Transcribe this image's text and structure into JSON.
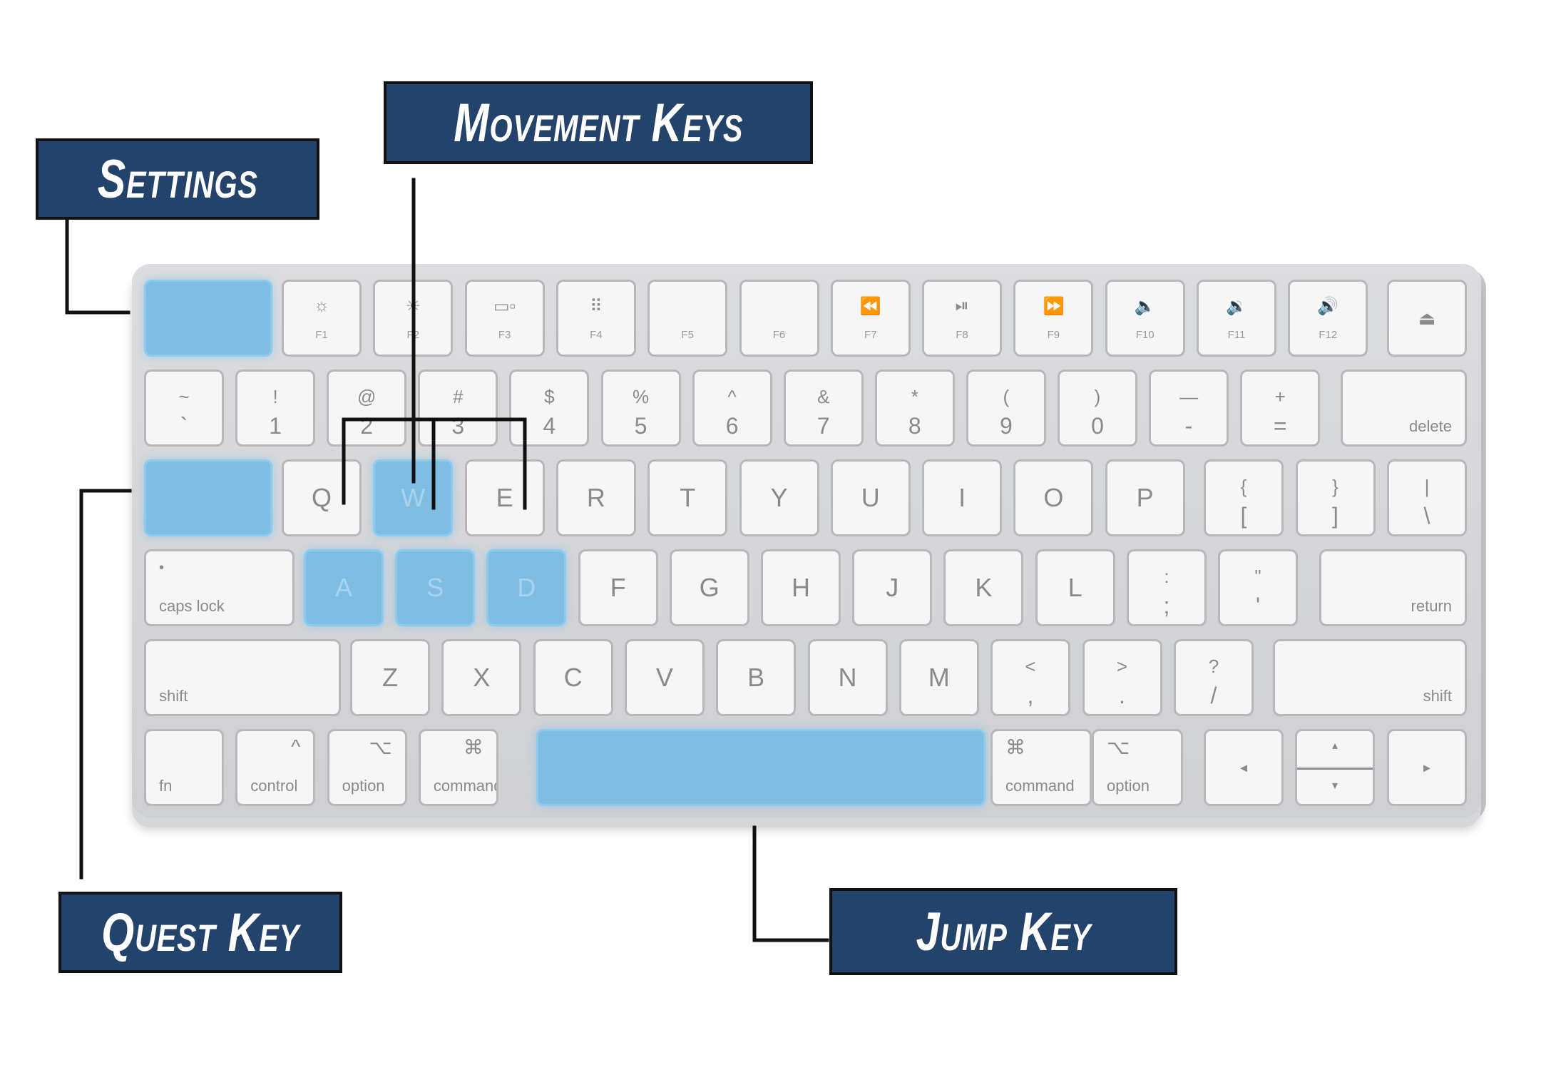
{
  "labels": {
    "settings": "Settings",
    "movement_keys": "Movement Keys",
    "quest_key": "Quest Key",
    "jump_key": "Jump Key"
  },
  "colors": {
    "highlight": "#7fbde2",
    "label_background": "#24436b",
    "label_text": "#ffffff",
    "leader_line": "#111111",
    "keyboard_body": "#d4d5d8",
    "key_face": "#f6f6f7"
  },
  "keyboard": {
    "function_row": {
      "escape": {
        "highlighted": true
      },
      "keys": [
        {
          "icon": "brightness-down-icon",
          "glyph": "☼",
          "label": "F1"
        },
        {
          "icon": "brightness-up-icon",
          "glyph": "☀",
          "label": "F2"
        },
        {
          "icon": "mission-control-icon",
          "glyph": "▭▫",
          "label": "F3"
        },
        {
          "icon": "launchpad-icon",
          "glyph": "⠿",
          "label": "F4"
        },
        {
          "icon": "",
          "glyph": "",
          "label": "F5"
        },
        {
          "icon": "",
          "glyph": "",
          "label": "F6"
        },
        {
          "icon": "rewind-icon",
          "glyph": "⏪",
          "label": "F7"
        },
        {
          "icon": "play-pause-icon",
          "glyph": "⏯",
          "label": "F8"
        },
        {
          "icon": "fast-forward-icon",
          "glyph": "⏩",
          "label": "F9"
        },
        {
          "icon": "mute-icon",
          "glyph": "🔈",
          "label": "F10"
        },
        {
          "icon": "volume-down-icon",
          "glyph": "🔉",
          "label": "F11"
        },
        {
          "icon": "volume-up-icon",
          "glyph": "🔊",
          "label": "F12"
        }
      ],
      "eject": {
        "icon": "eject-icon",
        "glyph": "⏏"
      }
    },
    "number_row": [
      {
        "top": "~",
        "bottom": "`"
      },
      {
        "top": "!",
        "bottom": "1"
      },
      {
        "top": "@",
        "bottom": "2"
      },
      {
        "top": "#",
        "bottom": "3"
      },
      {
        "top": "$",
        "bottom": "4"
      },
      {
        "top": "%",
        "bottom": "5"
      },
      {
        "top": "^",
        "bottom": "6"
      },
      {
        "top": "&",
        "bottom": "7"
      },
      {
        "top": "*",
        "bottom": "8"
      },
      {
        "top": "(",
        "bottom": "9"
      },
      {
        "top": ")",
        "bottom": "0"
      },
      {
        "top": "—",
        "bottom": "-"
      },
      {
        "top": "+",
        "bottom": "="
      }
    ],
    "delete": "delete",
    "top_letters": [
      {
        "label": "Q",
        "highlighted": false
      },
      {
        "label": "W",
        "highlighted": true
      },
      {
        "label": "E",
        "highlighted": false
      },
      {
        "label": "R",
        "highlighted": false
      },
      {
        "label": "T",
        "highlighted": false
      },
      {
        "label": "Y",
        "highlighted": false
      },
      {
        "label": "U",
        "highlighted": false
      },
      {
        "label": "I",
        "highlighted": false
      },
      {
        "label": "O",
        "highlighted": false
      },
      {
        "label": "P",
        "highlighted": false
      }
    ],
    "brackets": [
      {
        "top": "{",
        "bottom": "["
      },
      {
        "top": "}",
        "bottom": "]"
      },
      {
        "top": "|",
        "bottom": "\\"
      }
    ],
    "tab": {
      "highlighted": true
    },
    "caps_lock": {
      "dot": "•",
      "label": "caps lock"
    },
    "home_letters": [
      {
        "label": "A",
        "highlighted": true
      },
      {
        "label": "S",
        "highlighted": true
      },
      {
        "label": "D",
        "highlighted": true
      },
      {
        "label": "F",
        "highlighted": false
      },
      {
        "label": "G",
        "highlighted": false
      },
      {
        "label": "H",
        "highlighted": false
      },
      {
        "label": "J",
        "highlighted": false
      },
      {
        "label": "K",
        "highlighted": false
      },
      {
        "label": "L",
        "highlighted": false
      }
    ],
    "home_punct": [
      {
        "top": ":",
        "bottom": ";"
      },
      {
        "top": "\"",
        "bottom": "'"
      }
    ],
    "return": "return",
    "shift_left": "shift",
    "bottom_letters": [
      "Z",
      "X",
      "C",
      "V",
      "B",
      "N",
      "M"
    ],
    "bottom_punct": [
      {
        "top": "<",
        "bottom": ","
      },
      {
        "top": ">",
        "bottom": "."
      },
      {
        "top": "?",
        "bottom": "/"
      }
    ],
    "shift_right": "shift",
    "modifiers_left": [
      {
        "symbol": "",
        "label": "fn"
      },
      {
        "symbol": "^",
        "label": "control"
      },
      {
        "symbol": "⌥",
        "label": "option"
      },
      {
        "symbol": "⌘",
        "label": "command"
      }
    ],
    "space": {
      "highlighted": true
    },
    "modifiers_right": [
      {
        "symbol": "⌘",
        "label": "command"
      },
      {
        "symbol": "⌥",
        "label": "option"
      }
    ],
    "arrows": {
      "left": "◂",
      "up": "▴",
      "down": "▾",
      "right": "▸"
    }
  }
}
